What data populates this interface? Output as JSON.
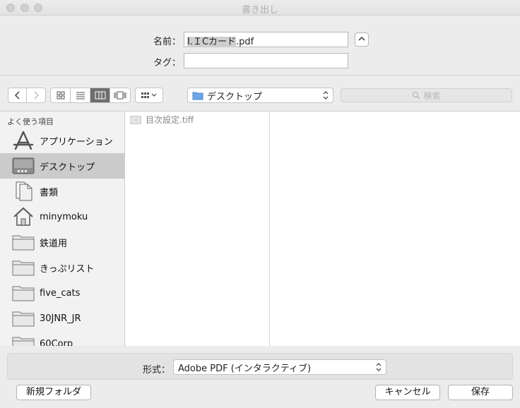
{
  "window": {
    "title": "書き出し"
  },
  "save_as": {
    "label": "名前：",
    "value_selected": "I.ＩCカード",
    "value_rest": ".pdf"
  },
  "tags": {
    "label": "タグ：",
    "value": ""
  },
  "toolbar": {
    "location": "デスクトップ",
    "search_placeholder": "検索"
  },
  "sidebar": {
    "header": "よく使う項目",
    "items": [
      {
        "label": "アプリケーション",
        "icon": "applications-icon"
      },
      {
        "label": "デスクトップ",
        "icon": "desktop-icon",
        "selected": true
      },
      {
        "label": "書類",
        "icon": "documents-icon"
      },
      {
        "label": "minymoku",
        "icon": "home-icon"
      },
      {
        "label": "鉄道用",
        "icon": "folder-icon"
      },
      {
        "label": "きっぷリスト",
        "icon": "folder-icon"
      },
      {
        "label": "five_cats",
        "icon": "folder-icon"
      },
      {
        "label": "30JNR_JR",
        "icon": "folder-icon"
      },
      {
        "label": "60Corp",
        "icon": "folder-icon"
      }
    ]
  },
  "files": [
    {
      "name": "目次設定.tiff"
    }
  ],
  "format": {
    "label": "形式：",
    "value": "Adobe PDF (インタラクティブ)"
  },
  "buttons": {
    "new_folder": "新規フォルダ",
    "cancel": "キャンセル",
    "save": "保存"
  }
}
